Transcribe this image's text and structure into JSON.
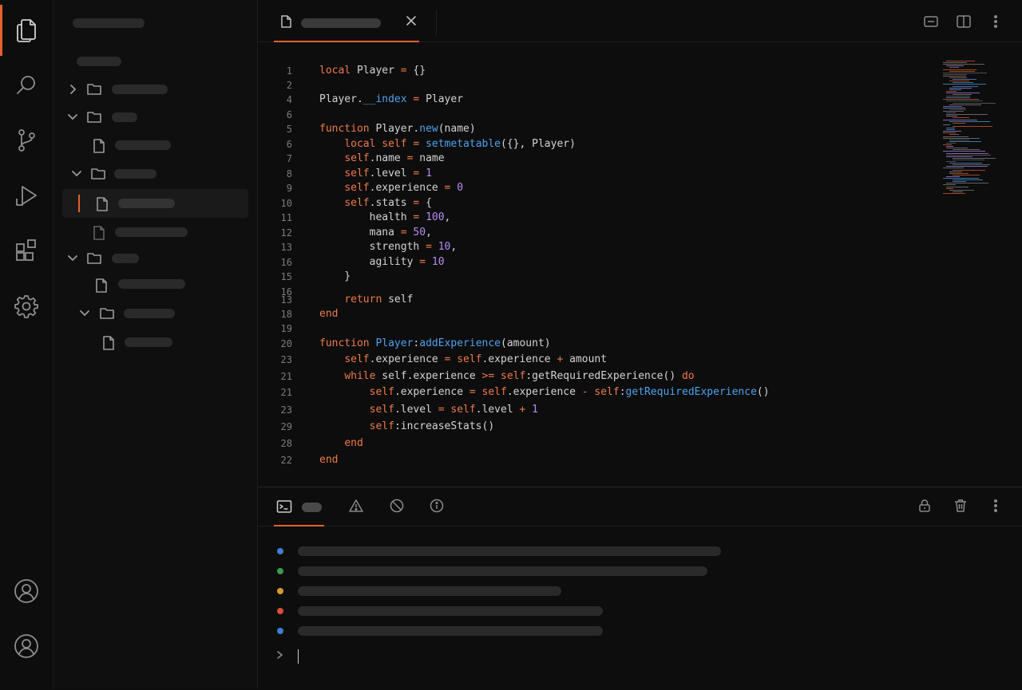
{
  "activity_bar": {
    "items": [
      {
        "icon": "files-icon",
        "active": true
      },
      {
        "icon": "search-icon",
        "active": false
      },
      {
        "icon": "source-control-icon",
        "active": false
      },
      {
        "icon": "run-debug-icon",
        "active": false
      },
      {
        "icon": "extensions-icon",
        "active": false
      },
      {
        "icon": "settings-gear-icon",
        "active": false
      }
    ],
    "bottom_items": [
      {
        "icon": "account-icon"
      },
      {
        "icon": "account-icon"
      }
    ]
  },
  "editor": {
    "tab": {
      "icon": "file-icon",
      "close_icon": "close-icon"
    },
    "toolbar_icons": [
      "open-preview-icon",
      "split-editor-icon",
      "more-actions-icon"
    ],
    "code_lines": [
      {
        "ln": "1",
        "tokens": [
          {
            "t": "local",
            "c": "kw"
          },
          {
            "t": " Player "
          },
          {
            "t": "=",
            "c": "op"
          },
          {
            "t": " {}"
          }
        ]
      },
      {
        "ln": "2",
        "tokens": []
      },
      {
        "ln": "4",
        "tokens": [
          {
            "t": "Player."
          },
          {
            "t": "__index",
            "c": "fn"
          },
          {
            "t": " "
          },
          {
            "t": "=",
            "c": "op"
          },
          {
            "t": " Player"
          }
        ]
      },
      {
        "ln": "6",
        "tokens": []
      },
      {
        "ln": "5",
        "tokens": [
          {
            "t": "function",
            "c": "kw"
          },
          {
            "t": " Player."
          },
          {
            "t": "new",
            "c": "fn"
          },
          {
            "t": "(name)"
          }
        ]
      },
      {
        "ln": "6",
        "tokens": [
          {
            "t": "    "
          },
          {
            "t": "local",
            "c": "kw"
          },
          {
            "t": " "
          },
          {
            "t": "self",
            "c": "kw"
          },
          {
            "t": " "
          },
          {
            "t": "=",
            "c": "op"
          },
          {
            "t": " "
          },
          {
            "t": "setmetatable",
            "c": "fn"
          },
          {
            "t": "({}, Player)"
          }
        ]
      },
      {
        "ln": "7",
        "tokens": [
          {
            "t": "    "
          },
          {
            "t": "self",
            "c": "kw"
          },
          {
            "t": ".name "
          },
          {
            "t": "=",
            "c": "op"
          },
          {
            "t": " name"
          }
        ]
      },
      {
        "ln": "8",
        "tokens": [
          {
            "t": "    "
          },
          {
            "t": "self",
            "c": "kw"
          },
          {
            "t": ".level "
          },
          {
            "t": "=",
            "c": "op"
          },
          {
            "t": " "
          },
          {
            "t": "1",
            "c": "num"
          }
        ]
      },
      {
        "ln": "9",
        "tokens": [
          {
            "t": "    "
          },
          {
            "t": "self",
            "c": "kw"
          },
          {
            "t": ".experience "
          },
          {
            "t": "=",
            "c": "op"
          },
          {
            "t": " "
          },
          {
            "t": "0",
            "c": "num"
          }
        ]
      },
      {
        "ln": "10",
        "tokens": [
          {
            "t": "    "
          },
          {
            "t": "self",
            "c": "kw"
          },
          {
            "t": ".stats "
          },
          {
            "t": "=",
            "c": "op"
          },
          {
            "t": " {"
          }
        ]
      },
      {
        "ln": "11",
        "tokens": [
          {
            "t": "        health "
          },
          {
            "t": "=",
            "c": "op"
          },
          {
            "t": " "
          },
          {
            "t": "100",
            "c": "num"
          },
          {
            "t": ","
          }
        ]
      },
      {
        "ln": "12",
        "tokens": [
          {
            "t": "        mana "
          },
          {
            "t": "=",
            "c": "op"
          },
          {
            "t": " "
          },
          {
            "t": "50",
            "c": "num"
          },
          {
            "t": ","
          }
        ]
      },
      {
        "ln": "13",
        "tokens": [
          {
            "t": "        strength "
          },
          {
            "t": "=",
            "c": "op"
          },
          {
            "t": " "
          },
          {
            "t": "10",
            "c": "num"
          },
          {
            "t": ","
          }
        ]
      },
      {
        "ln": "16",
        "tokens": [
          {
            "t": "        agility "
          },
          {
            "t": "=",
            "c": "op"
          },
          {
            "t": " "
          },
          {
            "t": "10",
            "c": "num"
          }
        ]
      },
      {
        "ln": "15",
        "tokens": [
          {
            "t": "    }"
          }
        ]
      },
      {
        "ln": "16",
        "tokens": []
      },
      {
        "ln": "13",
        "tokens": [
          {
            "t": "    "
          },
          {
            "t": "return",
            "c": "kw"
          },
          {
            "t": " self"
          }
        ]
      },
      {
        "ln": "18",
        "tokens": [
          {
            "t": "end",
            "c": "kw"
          }
        ]
      },
      {
        "ln": "19",
        "tokens": []
      },
      {
        "ln": "20",
        "tokens": [
          {
            "t": "function",
            "c": "kw"
          },
          {
            "t": " "
          },
          {
            "t": "Player",
            "c": "fn"
          },
          {
            "t": ":"
          },
          {
            "t": "addExperience",
            "c": "fn"
          },
          {
            "t": "(amount)"
          }
        ]
      },
      {
        "ln": "23",
        "tokens": [
          {
            "t": "    "
          },
          {
            "t": "self",
            "c": "kw"
          },
          {
            "t": ".experience "
          },
          {
            "t": "=",
            "c": "op"
          },
          {
            "t": " "
          },
          {
            "t": "self",
            "c": "kw"
          },
          {
            "t": ".experience "
          },
          {
            "t": "+",
            "c": "op"
          },
          {
            "t": " amount"
          }
        ]
      },
      {
        "ln": "21",
        "tokens": [
          {
            "t": "    "
          },
          {
            "t": "while",
            "c": "kw"
          },
          {
            "t": " self.experience "
          },
          {
            "t": ">=",
            "c": "op"
          },
          {
            "t": " "
          },
          {
            "t": "self",
            "c": "kw"
          },
          {
            "t": ":getRequiredExperience() "
          },
          {
            "t": "do",
            "c": "kw"
          }
        ]
      },
      {
        "ln": "21",
        "tokens": [
          {
            "t": "        "
          },
          {
            "t": "self",
            "c": "kw"
          },
          {
            "t": ".experience "
          },
          {
            "t": "=",
            "c": "op"
          },
          {
            "t": " "
          },
          {
            "t": "self",
            "c": "kw"
          },
          {
            "t": ".experience "
          },
          {
            "t": "-",
            "c": "op"
          },
          {
            "t": " "
          },
          {
            "t": "self",
            "c": "kw"
          },
          {
            "t": ":"
          },
          {
            "t": "getRequiredExperience",
            "c": "fn"
          },
          {
            "t": "()"
          }
        ]
      },
      {
        "ln": "23",
        "tokens": [
          {
            "t": "        "
          },
          {
            "t": "self",
            "c": "kw"
          },
          {
            "t": ".level "
          },
          {
            "t": "=",
            "c": "op"
          },
          {
            "t": " "
          },
          {
            "t": "self",
            "c": "kw"
          },
          {
            "t": ".level "
          },
          {
            "t": "+",
            "c": "op"
          },
          {
            "t": " "
          },
          {
            "t": "1",
            "c": "num"
          }
        ]
      },
      {
        "ln": "29",
        "tokens": [
          {
            "t": "        "
          },
          {
            "t": "self",
            "c": "kw"
          },
          {
            "t": ":increaseStats()"
          }
        ]
      },
      {
        "ln": "28",
        "tokens": [
          {
            "t": "    "
          },
          {
            "t": "end",
            "c": "kw"
          }
        ]
      },
      {
        "ln": "22",
        "tokens": [
          {
            "t": "end",
            "c": "kw"
          }
        ]
      }
    ]
  },
  "panel": {
    "tab_icons": [
      "terminal-icon",
      "warning-icon",
      "error-icon",
      "info-icon"
    ],
    "action_icons": [
      "lock-icon",
      "trash-icon",
      "more-actions-icon"
    ],
    "log_colors": [
      "#3d7fd0",
      "#3c9a4e",
      "#d49a30",
      "#d4503c",
      "#3d7fd0"
    ],
    "prompt_symbol": ">"
  }
}
